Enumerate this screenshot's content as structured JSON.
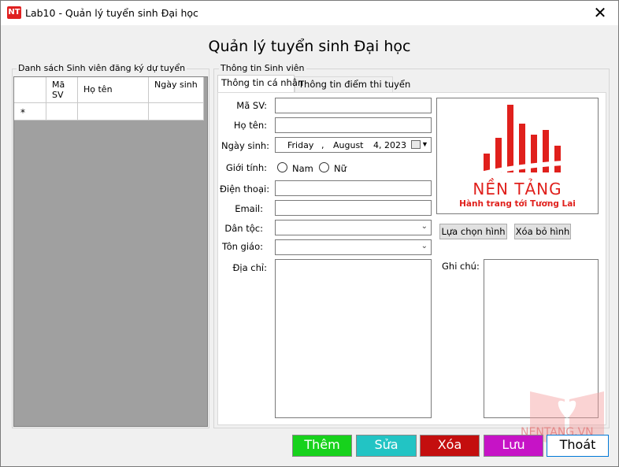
{
  "window": {
    "title": "Lab10 - Quản lý tuyển sinh Đại học",
    "icon_text": "NT",
    "close_glyph": "✕"
  },
  "heading": "Quản lý tuyển sinh Đại học",
  "student_list": {
    "legend": "Danh sách Sinh viên đăng ký dự tuyển",
    "columns": [
      "Mã SV",
      "Họ tên",
      "Ngày sinh"
    ],
    "new_row_marker": "*"
  },
  "info_group": {
    "legend": "Thông tin Sinh viên",
    "tabs": [
      "Thông tin cá nhân",
      "Thông tin điểm thi tuyển"
    ],
    "fields": {
      "ma_sv": {
        "label": "Mã SV:",
        "value": ""
      },
      "ho_ten": {
        "label": "Họ tên:",
        "value": ""
      },
      "ngay_sinh": {
        "label": "Ngày sinh:",
        "day_name": "Friday",
        "sep": ",",
        "month": "August",
        "day_year": "4, 2023"
      },
      "gioi_tinh": {
        "label": "Giới tính:",
        "options": [
          "Nam",
          "Nữ"
        ]
      },
      "dien_thoai": {
        "label": "Điện thoại:",
        "value": ""
      },
      "email": {
        "label": "Email:",
        "value": ""
      },
      "dan_toc": {
        "label": "Dân tộc:",
        "value": ""
      },
      "ton_giao": {
        "label": "Tôn giáo:",
        "value": ""
      },
      "dia_chi": {
        "label": "Địa chỉ:",
        "value": ""
      },
      "ghi_chu": {
        "label": "Ghi chú:",
        "value": ""
      }
    },
    "image_buttons": {
      "choose": "Lựa chọn hình",
      "remove": "Xóa bỏ hình"
    },
    "logo": {
      "title": "NỀN TẢNG",
      "subtitle": "Hành trang tới Tương Lai",
      "color": "#e0201c"
    }
  },
  "actions": [
    {
      "label": "Thêm",
      "bg": "#17d21c",
      "fg": "#ffffff"
    },
    {
      "label": "Sửa",
      "bg": "#22c4c4",
      "fg": "#ffffff"
    },
    {
      "label": "Xóa",
      "bg": "#c40e0e",
      "fg": "#ffffff"
    },
    {
      "label": "Lưu",
      "bg": "#c613c6",
      "fg": "#ffffff"
    },
    {
      "label": "Thoát",
      "bg": "#ffffff",
      "fg": "#000000"
    }
  ],
  "watermark": {
    "text": "NENTANG.VN"
  }
}
